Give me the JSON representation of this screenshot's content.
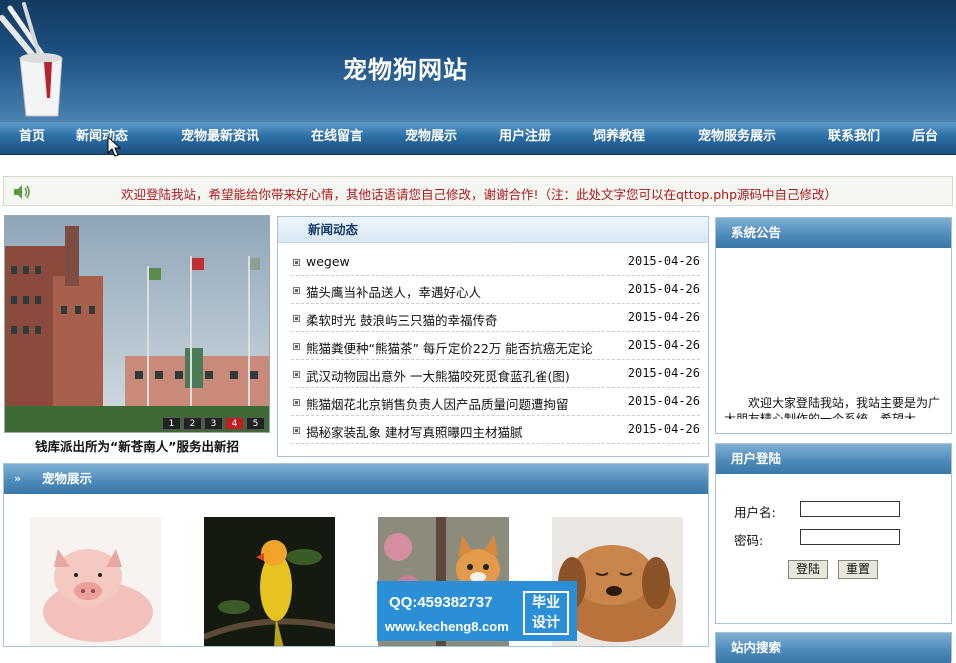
{
  "header": {
    "site_title": "宠物狗网站"
  },
  "nav": {
    "items": [
      {
        "label": "首页"
      },
      {
        "label": "新闻动态"
      },
      {
        "label": "宠物最新资讯"
      },
      {
        "label": "在线留言"
      },
      {
        "label": "宠物展示"
      },
      {
        "label": "用户注册"
      },
      {
        "label": "饲养教程"
      },
      {
        "label": "宠物服务展示"
      },
      {
        "label": "联系我们"
      },
      {
        "label": "后台"
      }
    ]
  },
  "notice": {
    "icon": "speaker-icon",
    "text": "欢迎登陆我站，希望能给你带来好心情，其他话语请您自己修改，谢谢合作!（注：此处文字您可以在qttop.php源码中自己修改）"
  },
  "slideshow": {
    "caption": "钱库派出所为“新苍南人”服务出新招",
    "pages": [
      "1",
      "2",
      "3",
      "4",
      "5"
    ],
    "active_page": "4"
  },
  "news": {
    "title": "新闻动态",
    "items": [
      {
        "title": "wegew",
        "date": "2015-04-26"
      },
      {
        "title": "猫头鹰当补品送人，幸遇好心人",
        "date": "2015-04-26"
      },
      {
        "title": "柔软时光 鼓浪屿三只猫的幸福传奇",
        "date": "2015-04-26"
      },
      {
        "title": "熊猫粪便种“熊猫茶” 每斤定价22万 能否抗癌无定论",
        "date": "2015-04-26"
      },
      {
        "title": "武汉动物园出意外 一大熊猫咬死觅食蓝孔雀(图)",
        "date": "2015-04-26"
      },
      {
        "title": "熊猫烟花北京销售负责人因产品质量问题遭拘留",
        "date": "2015-04-26"
      },
      {
        "title": "揭秘家装乱象 建材写真照曝四主材猫腻",
        "date": "2015-04-26"
      }
    ]
  },
  "announcement": {
    "title": "系统公告",
    "text": "欢迎大家登陆我站，我站主要是为广大朋友精心制作的一个系统，希望大"
  },
  "login": {
    "title": "用户登陆",
    "username_label": "用户名:",
    "password_label": "密码:",
    "login_button": "登陆",
    "reset_button": "重置",
    "username_value": "",
    "password_value": ""
  },
  "next_panel": {
    "title": "站内搜索"
  },
  "pets": {
    "title": "宠物展示"
  },
  "watermark": {
    "qq": "QQ:459382737",
    "url": "www.kecheng8.com",
    "badge_line1": "毕业",
    "badge_line2": "设计"
  },
  "colors": {
    "header": "#1d5283",
    "nav": "#2c6fa6",
    "notice_text": "#b01818",
    "panel_head": "#4b89b9"
  }
}
